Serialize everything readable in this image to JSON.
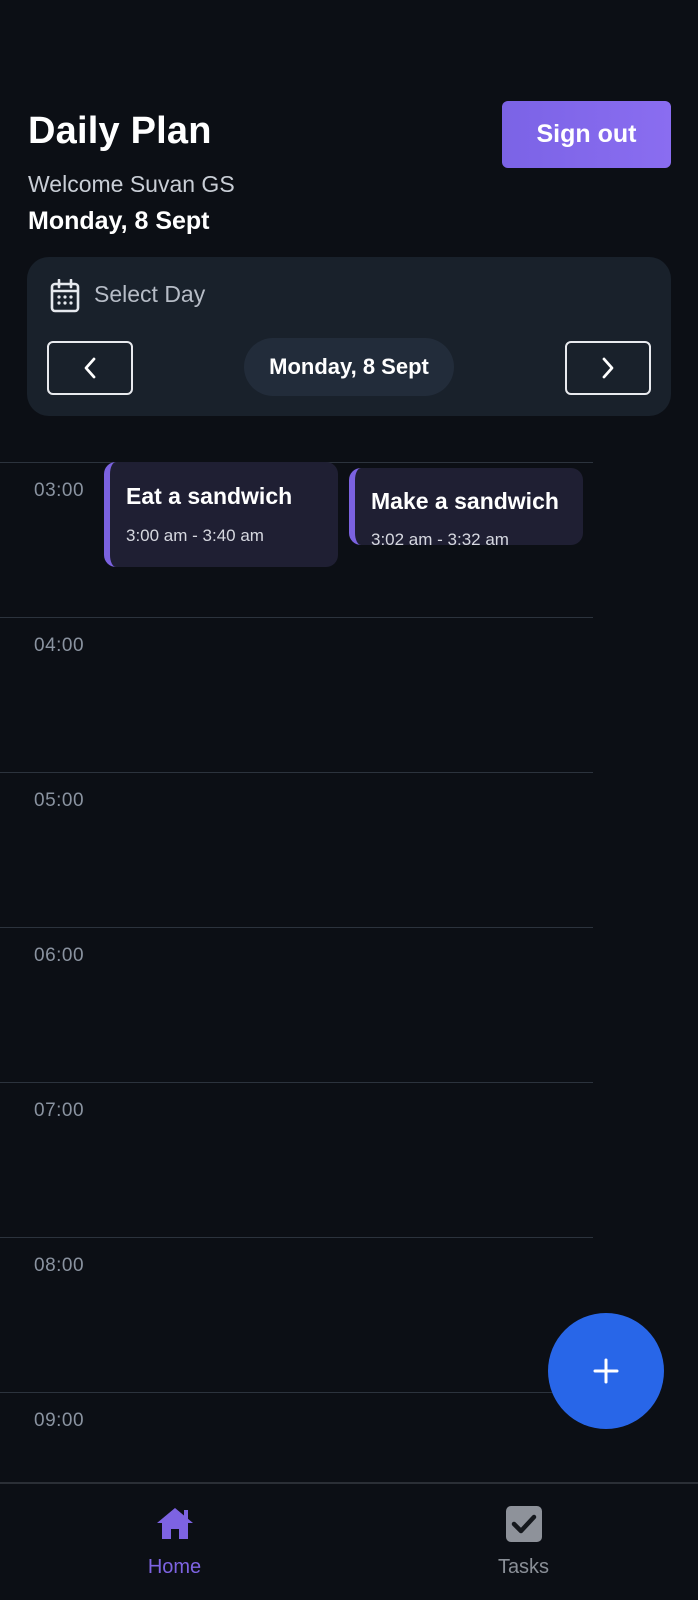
{
  "header": {
    "title": "Daily Plan",
    "welcome": "Welcome Suvan GS",
    "date": "Monday, 8 Sept",
    "sign_out_label": "Sign out"
  },
  "day_selector": {
    "label": "Select Day",
    "current_day": "Monday, 8 Sept",
    "icon": "calendar-icon",
    "prev_icon": "chevron-left-icon",
    "next_icon": "chevron-right-icon"
  },
  "timeline": {
    "hours": [
      "03:00",
      "04:00",
      "05:00",
      "06:00",
      "07:00",
      "08:00",
      "09:00"
    ]
  },
  "events": [
    {
      "title": "Eat a sandwich",
      "time": "3:00 am - 3:40 am"
    },
    {
      "title": "Make a sandwich",
      "time": "3:02 am - 3:32 am"
    }
  ],
  "fab": {
    "icon": "plus-icon"
  },
  "bottom_nav": {
    "items": [
      {
        "label": "Home",
        "icon": "home-icon",
        "active": true
      },
      {
        "label": "Tasks",
        "icon": "checkbox-icon",
        "active": false
      }
    ]
  },
  "colors": {
    "background": "#0c0f15",
    "accent": "#7b63e6",
    "fab": "#2866e8",
    "card": "#19212b"
  }
}
